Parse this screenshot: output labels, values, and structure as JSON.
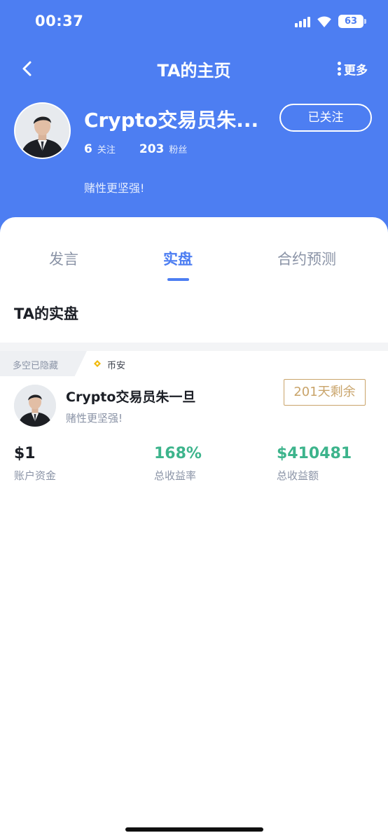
{
  "status_bar": {
    "time": "00:37",
    "battery": "63"
  },
  "nav": {
    "title": "TA的主页",
    "more_label": "更多"
  },
  "profile": {
    "name": "Crypto交易员朱...",
    "follow_button": "已关注",
    "following_count": "6",
    "following_label": "关注",
    "followers_count": "203",
    "followers_label": "粉丝",
    "bio": "赌性更坚强!"
  },
  "tabs": [
    {
      "label": "发言"
    },
    {
      "label": "实盘"
    },
    {
      "label": "合约预测"
    }
  ],
  "active_tab": "实盘",
  "section": {
    "title": "TA的实盘"
  },
  "trader_card": {
    "hidden_tag": "多空已隐藏",
    "exchange": "币安",
    "name": "Crypto交易员朱一旦",
    "bio": "赌性更坚强!",
    "days_remaining": "201天剩余",
    "metrics": [
      {
        "value": "$1",
        "label": "账户资金"
      },
      {
        "value": "168%",
        "label": "总收益率"
      },
      {
        "value": "$410481",
        "label": "总收益额"
      }
    ]
  },
  "colors": {
    "header_blue": "#4d7ef2",
    "profit_green": "#3db48c",
    "badge_gold": "#c9a46a",
    "muted_gray": "#8a93a6"
  }
}
